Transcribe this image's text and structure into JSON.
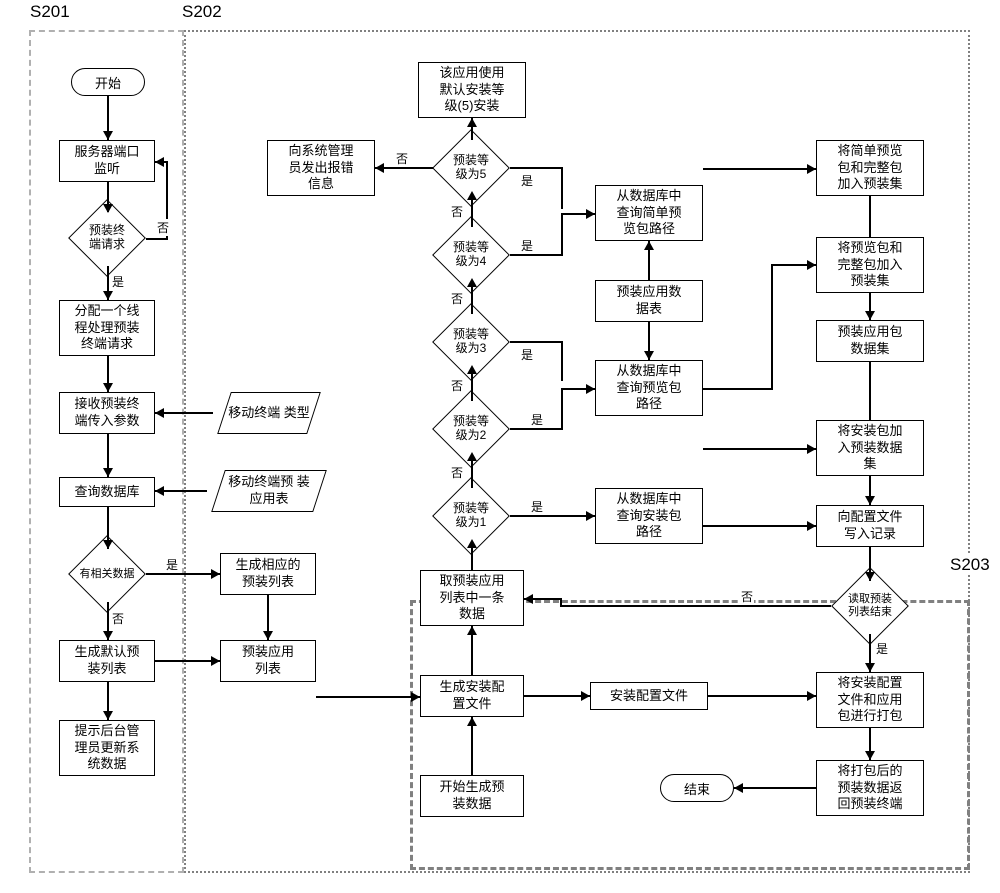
{
  "labels": {
    "s201": "S201",
    "s202": "S202",
    "s203": "S203"
  },
  "terminators": {
    "start": "开始",
    "end": "结束"
  },
  "nodes": {
    "n_listen": "服务器端口\n监听",
    "n_alloc_thread": "分配一个线\n程处理预装\n终端请求",
    "n_recv_params": "接收预装终\n端传入参数",
    "n_query_db": "查询数据库",
    "n_gen_default_list": "生成默认预\n装列表",
    "n_prompt_admin": "提示后台管\n理员更新系\n统数据",
    "n_gen_corresponding": "生成相应的\n预装列表",
    "n_preinstall_app_list": "预装应用\n列表",
    "n_use_default_level": "该应用使用\n默认安装等\n级(5)安装",
    "n_report_error": "向系统管理\n员发出报错\n信息",
    "n_take_one": "取预装应用\n列表中一条\n数据",
    "n_gen_config": "生成安装配\n置文件",
    "n_start_gen_data": "开始生成预\n装数据",
    "n_install_config_file": "安装配置文件",
    "n_query_install_pkg": "从数据库中\n查询安装包\n路径",
    "n_query_preview_pkg": "从数据库中\n查询预览包\n路径",
    "n_preinstall_app_data_table": "预装应用数\n据表",
    "n_query_simple_preview_pkg": "从数据库中\n查询简单预\n览包路径",
    "n_add_simple_full_to_set": "将简单预览\n包和完整包\n加入预装集",
    "n_add_preview_full_to_set": "将预览包和\n完整包加入\n预装集",
    "n_preinstall_app_pkg_set": "预装应用包\n数据集",
    "n_add_install_to_set": "将安装包加\n入预装数据\n集",
    "n_write_config": "向配置文件\n写入记录",
    "n_package_files": "将安装配置\n文件和应用\n包进行打包",
    "n_return_data": "将打包后的\n预装数据返\n回预装终端"
  },
  "data_nodes": {
    "d_terminal_type": "移动终端\n类型",
    "d_preinstall_app_table": "移动终端预\n装应用表"
  },
  "decisions": {
    "q_terminal_req": "预装终\n端请求",
    "q_has_data": "有相关数据",
    "q_level5": "预装等\n级为5",
    "q_level4": "预装等\n级为4",
    "q_level3": "预装等\n级为3",
    "q_level2": "预装等\n级为2",
    "q_level1": "预装等\n级为1",
    "q_read_end": "读取预装\n列表结束"
  },
  "edges": {
    "yes": "是",
    "no": "否"
  },
  "chart_data": {
    "type": "flowchart",
    "sections": [
      "S201",
      "S202",
      "S203"
    ],
    "terminators": [
      "开始",
      "结束"
    ],
    "processes": [
      "服务器端口监听",
      "分配一个线程处理预装终端请求",
      "接收预装终端传入参数",
      "查询数据库",
      "生成默认预装列表",
      "提示后台管理员更新系统数据",
      "生成相应的预装列表",
      "预装应用列表",
      "该应用使用默认安装等级(5)安装",
      "向系统管理员发出报错信息",
      "取预装应用列表中一条数据",
      "生成安装配置文件",
      "开始生成预装数据",
      "安装配置文件",
      "从数据库中查询安装包路径",
      "从数据库中查询预览包路径",
      "预装应用数据表",
      "从数据库中查询简单预览包路径",
      "将简单预览包和完整包加入预装集",
      "将预览包和完整包加入预装集",
      "预装应用包数据集",
      "将安装包加入预装数据集",
      "向配置文件写入记录",
      "将安装配置文件和应用包进行打包",
      "将打包后的预装数据返回预装终端"
    ],
    "data_nodes": [
      "移动终端类型",
      "移动终端预装应用表"
    ],
    "decisions": [
      "预装终端请求",
      "有相关数据",
      "预装等级为5",
      "预装等级为4",
      "预装等级为3",
      "预装等级为2",
      "预装等级为1",
      "读取预装列表结束"
    ],
    "flow": [
      {
        "from": "开始",
        "to": "服务器端口监听"
      },
      {
        "from": "服务器端口监听",
        "to": "预装终端请求"
      },
      {
        "from": "预装终端请求",
        "to": "服务器端口监听",
        "label": "否"
      },
      {
        "from": "预装终端请求",
        "to": "分配一个线程处理预装终端请求",
        "label": "是"
      },
      {
        "from": "分配一个线程处理预装终端请求",
        "to": "接收预装终端传入参数"
      },
      {
        "from": "移动终端类型",
        "to": "接收预装终端传入参数"
      },
      {
        "from": "接收预装终端传入参数",
        "to": "查询数据库"
      },
      {
        "from": "移动终端预装应用表",
        "to": "查询数据库"
      },
      {
        "from": "查询数据库",
        "to": "有相关数据"
      },
      {
        "from": "有相关数据",
        "to": "生成相应的预装列表",
        "label": "是"
      },
      {
        "from": "有相关数据",
        "to": "生成默认预装列表",
        "label": "否"
      },
      {
        "from": "生成默认预装列表",
        "to": "提示后台管理员更新系统数据"
      },
      {
        "from": "生成默认预装列表",
        "to": "预装应用列表"
      },
      {
        "from": "生成相应的预装列表",
        "to": "预装应用列表"
      },
      {
        "from": "预装应用列表",
        "to": "生成安装配置文件"
      },
      {
        "from": "开始生成预装数据",
        "to": "生成安装配置文件"
      },
      {
        "from": "生成安装配置文件",
        "to": "安装配置文件"
      },
      {
        "from": "生成安装配置文件",
        "to": "取预装应用列表中一条数据"
      },
      {
        "from": "取预装应用列表中一条数据",
        "to": "预装等级为1"
      },
      {
        "from": "预装等级为1",
        "to": "从数据库中查询安装包路径",
        "label": "是"
      },
      {
        "from": "预装等级为1",
        "to": "预装等级为2",
        "label": "否"
      },
      {
        "from": "预装等级为2",
        "to": "从数据库中查询预览包路径",
        "label": "是"
      },
      {
        "from": "预装等级为2",
        "to": "预装等级为3",
        "label": "否"
      },
      {
        "from": "预装等级为3",
        "to": "从数据库中查询预览包路径",
        "label": "是"
      },
      {
        "from": "预装等级为3",
        "to": "预装等级为4",
        "label": "否"
      },
      {
        "from": "预装等级为4",
        "to": "从数据库中查询简单预览包路径",
        "label": "是"
      },
      {
        "from": "预装等级为4",
        "to": "预装等级为5",
        "label": "否"
      },
      {
        "from": "预装等级为5",
        "to": "从数据库中查询简单预览包路径",
        "label": "是"
      },
      {
        "from": "预装等级为5",
        "to": "向系统管理员发出报错信息",
        "label": "否"
      },
      {
        "from": "预装等级为5",
        "to": "该应用使用默认安装等级(5)安装"
      },
      {
        "from": "预装应用数据表",
        "to": "从数据库中查询简单预览包路径"
      },
      {
        "from": "预装应用数据表",
        "to": "从数据库中查询预览包路径"
      },
      {
        "from": "从数据库中查询安装包路径",
        "to": "将安装包加入预装数据集"
      },
      {
        "from": "从数据库中查询预览包路径",
        "to": "将预览包和完整包加入预装集"
      },
      {
        "from": "从数据库中查询简单预览包路径",
        "to": "将简单预览包和完整包加入预装集"
      },
      {
        "from": "将简单预览包和完整包加入预装集",
        "to": "预装应用包数据集"
      },
      {
        "from": "将预览包和完整包加入预装集",
        "to": "预装应用包数据集"
      },
      {
        "from": "将安装包加入预装数据集",
        "to": "向配置文件写入记录"
      },
      {
        "from": "预装应用包数据集",
        "to": "向配置文件写入记录"
      },
      {
        "from": "从数据库中查询安装包路径",
        "to": "向配置文件写入记录"
      },
      {
        "from": "向配置文件写入记录",
        "to": "读取预装列表结束"
      },
      {
        "from": "读取预装列表结束",
        "to": "取预装应用列表中一条数据",
        "label": "否"
      },
      {
        "from": "读取预装列表结束",
        "to": "将安装配置文件和应用包进行打包",
        "label": "是"
      },
      {
        "from": "安装配置文件",
        "to": "将安装配置文件和应用包进行打包"
      },
      {
        "from": "将安装配置文件和应用包进行打包",
        "to": "将打包后的预装数据返回预装终端"
      },
      {
        "from": "将打包后的预装数据返回预装终端",
        "to": "结束"
      }
    ]
  }
}
